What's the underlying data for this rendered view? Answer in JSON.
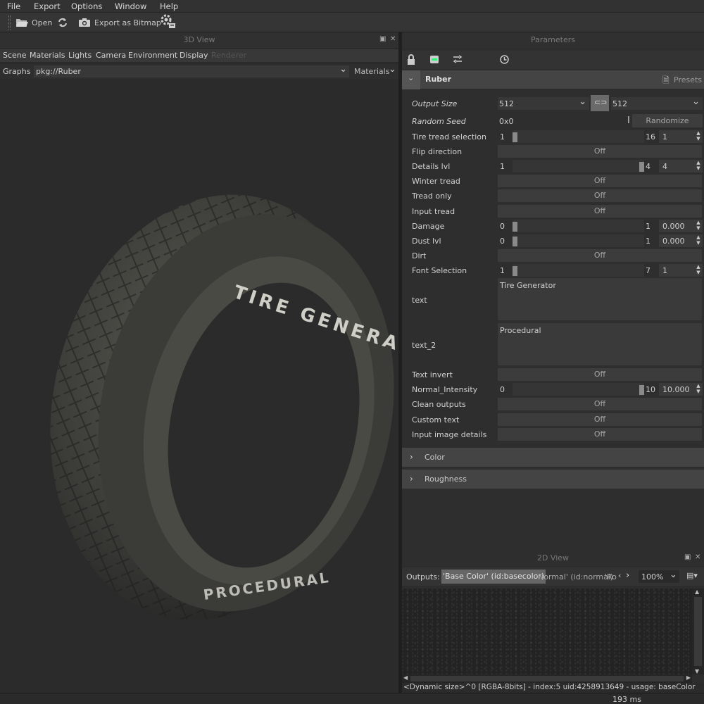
{
  "menu": [
    "File",
    "Export",
    "Options",
    "Window",
    "Help"
  ],
  "toolbar": {
    "open_label": "Open",
    "export_label": "Export as Bitmap"
  },
  "view3d": {
    "title": "3D View",
    "menu": [
      "Scene",
      "Materials",
      "Lights",
      "Camera",
      "Environment",
      "Display",
      "Renderer"
    ],
    "graphs_label": "Graphs :",
    "graphs_value": "pkg://Ruber",
    "materials_label": "Materials",
    "tire_text_top": "TIRE GENERATION",
    "tire_text_bottom": "PROCEDURAL"
  },
  "params": {
    "title": "Parameters",
    "group": "Ruber",
    "presets": "Presets",
    "output_size_label": "Output Size",
    "output_w": "512",
    "output_h": "512",
    "seed_label": "Random Seed",
    "seed_value": "0x0",
    "randomize": "Randomize",
    "rows": [
      {
        "label": "Tire tread selection",
        "min": "1",
        "max": "16",
        "value": "1",
        "knob": 0.0
      },
      {
        "label": "Flip direction",
        "toggle": "Off"
      },
      {
        "label": "Details lvl",
        "min": "1",
        "max": "4",
        "value": "4",
        "knob": 1.0
      },
      {
        "label": "Winter tread",
        "toggle": "Off"
      },
      {
        "label": "Tread only",
        "toggle": "Off"
      },
      {
        "label": "Input tread",
        "toggle": "Off"
      },
      {
        "label": "Damage",
        "min": "0",
        "max": "1",
        "value": "0.000",
        "knob": 0.0
      },
      {
        "label": "Dust lvl",
        "min": "0",
        "max": "1",
        "value": "0.000",
        "knob": 0.0
      },
      {
        "label": "Dirt",
        "toggle": "Off"
      },
      {
        "label": "Font Selection",
        "min": "1",
        "max": "7",
        "value": "1",
        "knob": 0.0
      }
    ],
    "text_label": "text",
    "text_value": "Tire Generator",
    "text2_label": "text_2",
    "text2_value": "Procedural",
    "rows2": [
      {
        "label": "Text invert",
        "toggle": "Off"
      },
      {
        "label": "Normal_Intensity",
        "min": "0",
        "max": "10",
        "value": "10.000",
        "knob": 1.0
      },
      {
        "label": "Clean outputs",
        "toggle": "Off"
      },
      {
        "label": "Custom text",
        "toggle": "Off"
      },
      {
        "label": "Input image details",
        "toggle": "Off"
      }
    ],
    "sections": [
      "Color",
      "Roughness"
    ]
  },
  "view2d": {
    "title": "2D View",
    "outputs_label": "Outputs:",
    "outputs": [
      "'Base Color' (id:basecolor)",
      "'Normal' (id:normal)",
      "'Ro"
    ],
    "zoom": "100%",
    "info": "<Dynamic size>^0 [RGBA-8bits] - index:5 uid:4258913649 - usage: baseColor"
  },
  "status": {
    "time": "193 ms"
  }
}
